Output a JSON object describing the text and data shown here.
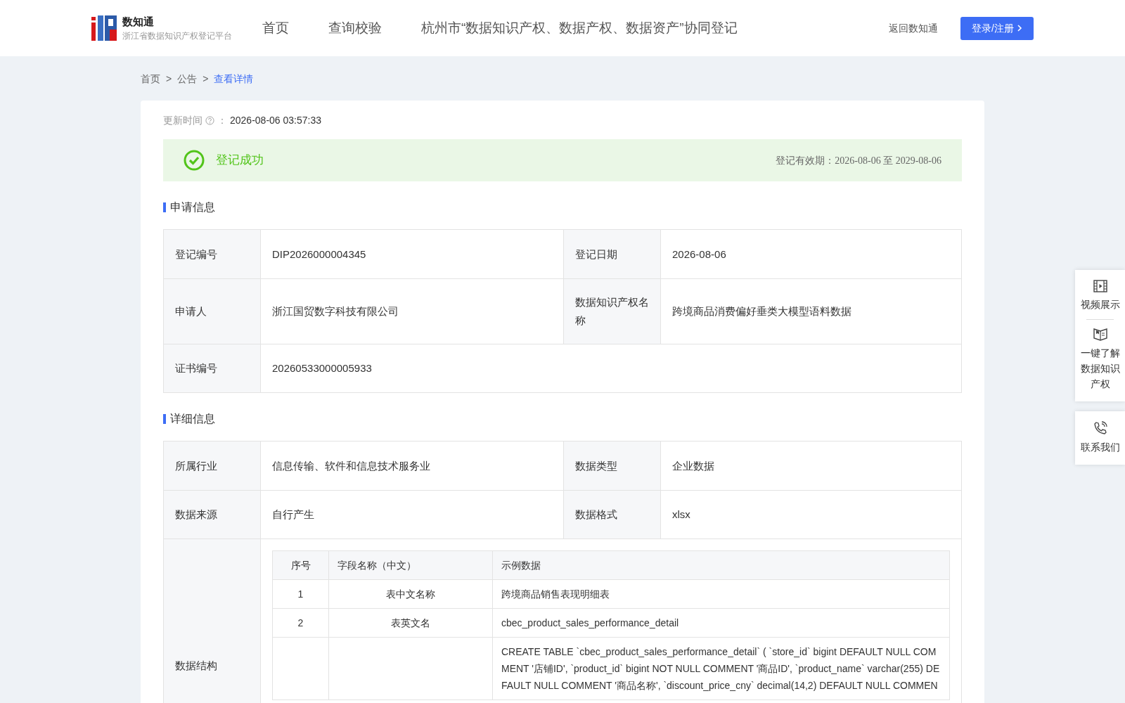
{
  "header": {
    "logo": {
      "title": "数知通",
      "subtitle": "浙江省数据知识产权登记平台"
    },
    "nav": [
      {
        "label": "首页"
      },
      {
        "label": "查询校验"
      },
      {
        "label": "杭州市“数据知识产权、数据产权、数据资产”协同登记"
      }
    ],
    "back_link": "返回数知通",
    "login_button": "登录/注册"
  },
  "breadcrumb": [
    {
      "label": "首页",
      "current": false
    },
    {
      "label": "公告",
      "current": false
    },
    {
      "label": "查看详情",
      "current": true
    }
  ],
  "breadcrumb_separator": ">",
  "update": {
    "label": "更新时间",
    "separator": "：",
    "value": "2026-08-06 03:57:33"
  },
  "status": {
    "kind": "success",
    "text": "登记成功",
    "validity": "登记有效期：2026-08-06 至 2029-08-06"
  },
  "sections": [
    {
      "title": "申请信息",
      "rows": [
        {
          "cells": [
            {
              "label": "登记编号",
              "value": "DIP2026000004345"
            },
            {
              "label": "登记日期",
              "value": "2026-08-06"
            }
          ]
        },
        {
          "cells": [
            {
              "label": "申请人",
              "value": "浙江国贸数字科技有限公司"
            },
            {
              "label": "数据知识产权名称",
              "value": "跨境商品消费偏好垂类大模型语料数据"
            }
          ]
        },
        {
          "cells": [
            {
              "label": "证书编号",
              "value": "20260533000005933"
            }
          ]
        }
      ]
    },
    {
      "title": "详细信息",
      "rows": [
        {
          "cells": [
            {
              "label": "所属行业",
              "value": "信息传输、软件和信息技术服务业"
            },
            {
              "label": "数据类型",
              "value": "企业数据"
            }
          ]
        },
        {
          "cells": [
            {
              "label": "数据来源",
              "value": "自行产生"
            },
            {
              "label": "数据格式",
              "value": "xlsx"
            }
          ]
        },
        {
          "cells": [
            {
              "label": "数据结构",
              "table": {
                "columns": [
                  "序号",
                  "字段名称（中文）",
                  "示例数据"
                ],
                "rows": [
                  {
                    "index": "1",
                    "name": "表中文名称",
                    "example": "跨境商品销售表现明细表"
                  },
                  {
                    "index": "2",
                    "name": "表英文名",
                    "example": "cbec_product_sales_performance_detail"
                  },
                  {
                    "example": "CREATE TABLE `cbec_product_sales_performance_detail` ( `store_id` bigint DEFAULT NULL COMMENT '店铺ID', `product_id` bigint NOT NULL COMMENT '商品ID', `product_name` varchar(255) DEFAULT NULL COMMENT '商品名称', `discount_price_cny` decimal(14,2) DEFAULT NULL COMMEN"
                  }
                ]
              }
            }
          ]
        }
      ]
    }
  ],
  "side_panel": [
    {
      "items": [
        {
          "label": "视频展示"
        },
        {
          "label": "一键了解数据知识产权"
        }
      ]
    },
    {
      "items": [
        {
          "label": "联系我们"
        }
      ]
    }
  ]
}
